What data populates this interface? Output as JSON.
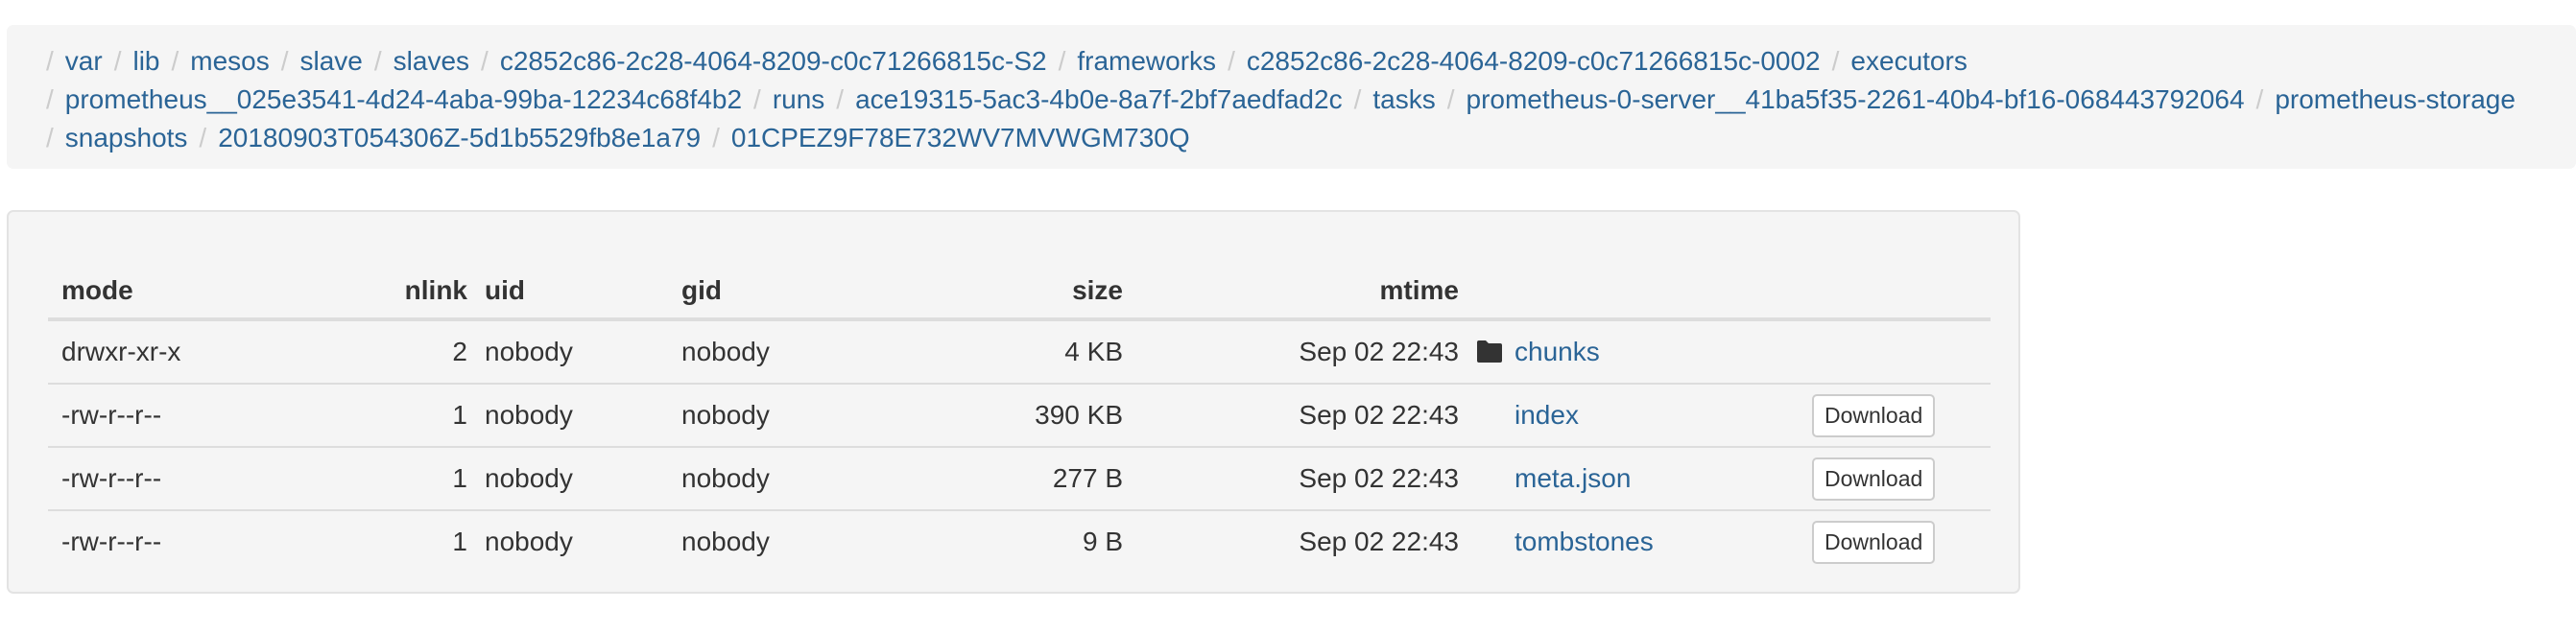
{
  "breadcrumb": {
    "separator": "/",
    "line1": [
      "var",
      "lib",
      "mesos",
      "slave",
      "slaves",
      "c2852c86-2c28-4064-8209-c0c71266815c-S2",
      "frameworks",
      "c2852c86-2c28-4064-8209-c0c71266815c-0002",
      "executors"
    ],
    "line2": [
      "prometheus__025e3541-4d24-4aba-99ba-12234c68f4b2",
      "runs",
      "ace19315-5ac3-4b0e-8a7f-2bf7aedfad2c",
      "tasks",
      "prometheus-0-server__41ba5f35-2261-40b4-bf16-068443792064",
      "prometheus-storage"
    ],
    "line3": [
      "snapshots",
      "20180903T054306Z-5d1b5529fb8e1a79",
      "01CPEZ9F78E732WV7MVWGM730Q"
    ]
  },
  "table": {
    "headers": {
      "mode": "mode",
      "nlink": "nlink",
      "uid": "uid",
      "gid": "gid",
      "size": "size",
      "mtime": "mtime"
    },
    "rows": [
      {
        "mode": "drwxr-xr-x",
        "nlink": "2",
        "uid": "nobody",
        "gid": "nobody",
        "size": "4 KB",
        "mtime": "Sep 02 22:43",
        "name": "chunks",
        "icon": "folder-icon",
        "download": ""
      },
      {
        "mode": "-rw-r--r--",
        "nlink": "1",
        "uid": "nobody",
        "gid": "nobody",
        "size": "390 KB",
        "mtime": "Sep 02 22:43",
        "name": "index",
        "icon": "",
        "download": "Download"
      },
      {
        "mode": "-rw-r--r--",
        "nlink": "1",
        "uid": "nobody",
        "gid": "nobody",
        "size": "277 B",
        "mtime": "Sep 02 22:43",
        "name": "meta.json",
        "icon": "",
        "download": "Download"
      },
      {
        "mode": "-rw-r--r--",
        "nlink": "1",
        "uid": "nobody",
        "gid": "nobody",
        "size": "9 B",
        "mtime": "Sep 02 22:43",
        "name": "tombstones",
        "icon": "",
        "download": "Download"
      }
    ]
  },
  "colors": {
    "link": "#2a6496",
    "panel": "#f5f5f5",
    "separator": "#cccccc"
  }
}
